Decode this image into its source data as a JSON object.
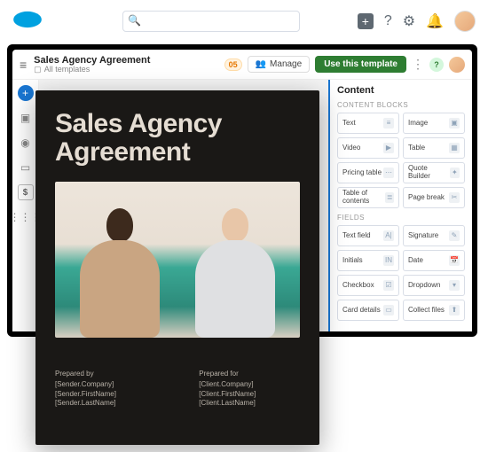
{
  "search": {
    "placeholder": ""
  },
  "header": {
    "title": "Sales Agency Agreement",
    "breadcrumb": "All templates",
    "badge": "05",
    "manage": "Manage",
    "use": "Use this template",
    "mini_badge": "?"
  },
  "panel": {
    "title": "Content",
    "section_blocks": "CONTENT BLOCKS",
    "section_fields": "FIELDS",
    "blocks": [
      {
        "label": "Text",
        "icon": "≡"
      },
      {
        "label": "Image",
        "icon": "▣"
      },
      {
        "label": "Video",
        "icon": "▶"
      },
      {
        "label": "Table",
        "icon": "▦"
      },
      {
        "label": "Pricing table",
        "icon": "⋯"
      },
      {
        "label": "Quote Builder",
        "icon": "✦"
      },
      {
        "label": "Table of contents",
        "icon": "≣"
      },
      {
        "label": "Page break",
        "icon": "✂"
      }
    ],
    "fields": [
      {
        "label": "Text field",
        "icon": "A|"
      },
      {
        "label": "Signature",
        "icon": "✎"
      },
      {
        "label": "Initials",
        "icon": "IN"
      },
      {
        "label": "Date",
        "icon": "📅"
      },
      {
        "label": "Checkbox",
        "icon": "☑"
      },
      {
        "label": "Dropdown",
        "icon": "▾"
      },
      {
        "label": "Card details",
        "icon": "▭"
      },
      {
        "label": "Collect files",
        "icon": "⬆"
      }
    ]
  },
  "doc": {
    "title": "Sales Agency Agreement",
    "prepared_by_label": "Prepared by",
    "prepared_by_1": "[Sender.Company]",
    "prepared_by_2": "[Sender.FirstName] [Sender.LastName]",
    "prepared_for_label": "Prepared for",
    "prepared_for_1": "[Client.Company]",
    "prepared_for_2": "[Client.FirstName] [Client.LastName]"
  }
}
